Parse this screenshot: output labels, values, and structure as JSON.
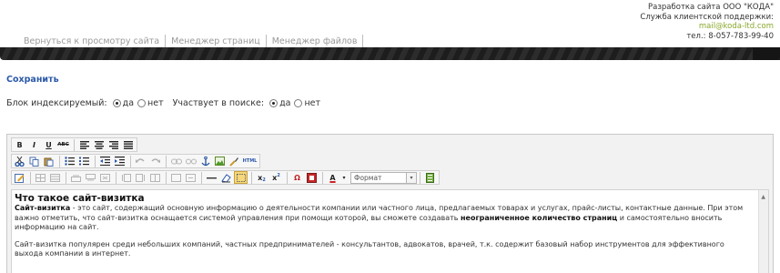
{
  "header": {
    "nav": [
      {
        "label": "Вернуться к просмотру сайта"
      },
      {
        "label": "Менеджер страниц"
      },
      {
        "label": "Менеджер файлов"
      }
    ],
    "contact": {
      "line1": "Разработка сайта ООО \"КОДА\"",
      "line2": "Служба клиентской поддержки:",
      "email": "mail@koda-ltd.com",
      "phone": "тел.: 8-057-783-99-40"
    }
  },
  "actions": {
    "save_label": "Сохранить"
  },
  "options": {
    "indexed_label": "Блок индексируемый:",
    "indexed_yes": "да",
    "indexed_no": "нет",
    "indexed_value": "да",
    "search_label": "Участвует в поиске:",
    "search_yes": "да",
    "search_no": "нет",
    "search_value": "да"
  },
  "toolbar": {
    "bold": "B",
    "italic": "I",
    "underline": "U",
    "strike": "ABC",
    "subscript": "x",
    "superscript": "x",
    "omega": "Ω",
    "text_color": "A",
    "format_select": "Формат",
    "spellcheck": "ABC"
  },
  "content": {
    "heading": "Что такое сайт-визитка",
    "p1_bold": "Сайт-визитка",
    "p1_text": " - это сайт, содержащий основную информацию о деятельности компании или частного лица, предлагаемых товарах и услугах, прайс-листы, контактные данные. При этом важно отметить, что сайт-визитка оснащается системой управления при помощи которой, вы сможете создавать ",
    "p1_bold2": "неограниченное количество страниц",
    "p1_text2": " и самостоятельно вносить информацию на сайт.",
    "p2_text": "Сайт-визитка популярен среди небольших компаний, частных предпринимателей - консультантов, адвокатов, врачей, т.к. содержит базовый набор инструментов для эффективного выхода компании в интернет."
  },
  "colors": {
    "link": "#2a58a8",
    "email": "#8aa82a",
    "stripe": "#1d1d1d"
  }
}
